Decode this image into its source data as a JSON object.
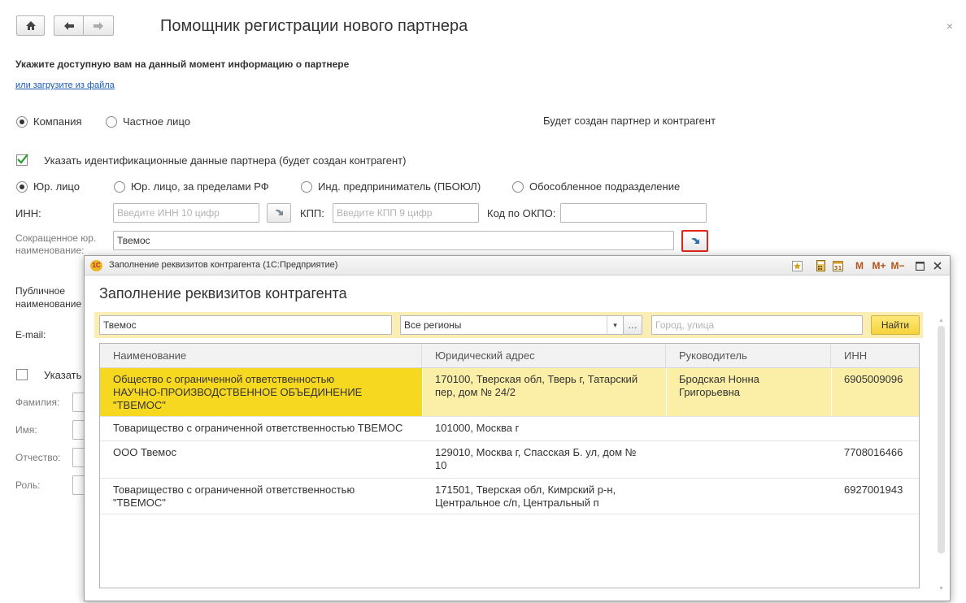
{
  "header": {
    "title": "Помощник регистрации нового партнера",
    "close_label": "×"
  },
  "intro": {
    "heading": "Укажите доступную вам на данный момент информацию о партнере",
    "load_link": "или загрузите из файла"
  },
  "partner_type": {
    "options": [
      "Компания",
      "Частное лицо"
    ],
    "selected": "Компания",
    "note": "Будет создан партнер и контрагент"
  },
  "identify": {
    "checkbox_label": "Указать идентификационные данные партнера (будет создан контрагент)",
    "checked": true
  },
  "legal_type": {
    "options": [
      "Юр. лицо",
      "Юр. лицо, за пределами РФ",
      "Инд. предприниматель (ПБОЮЛ)",
      "Обособленное подразделение"
    ],
    "selected": "Юр. лицо"
  },
  "form": {
    "inn_label": "ИНН:",
    "inn_placeholder": "Введите ИНН 10 цифр",
    "kpp_label": "КПП:",
    "kpp_placeholder": "Введите КПП 9 цифр",
    "okpo_label": "Код по ОКПО:",
    "short_name_label_1": "Сокращенное юр.",
    "short_name_label_2": "наименование:",
    "short_name_value": "Твемос",
    "public_label_1": "Публичное",
    "public_label_2": "наименование",
    "email_label": "E-mail:",
    "contact_checkbox_label": "Указать",
    "lastname_label": "Фамилия:",
    "firstname_label": "Имя:",
    "patronymic_label": "Отчество:",
    "role_label": "Роль:"
  },
  "dialog": {
    "window_title": "Заполнение реквизитов контрагента  (1С:Предприятие)",
    "logo_text": "1С",
    "toolbar": [
      "M",
      "M+",
      "M−"
    ],
    "heading": "Заполнение реквизитов контрагента",
    "search_value": "Твемос",
    "region_value": "Все регионы",
    "city_placeholder": "Город, улица",
    "find_button": "Найти",
    "columns": [
      "Наименование",
      "Юридический адрес",
      "Руководитель",
      "ИНН"
    ],
    "rows": [
      {
        "name": [
          "Общество с ограниченной ответственностью",
          "НАУЧНО-ПРОИЗВОДСТВЕННОЕ ОБЪЕДИНЕНИЕ",
          "\"ТВЕМОС\""
        ],
        "address": [
          "170100, Тверская обл, Тверь г, Татарский",
          "пер, дом № 24/2"
        ],
        "director": [
          "Бродская Нонна",
          "Григорьевна"
        ],
        "inn": "6905009096"
      },
      {
        "name": [
          "Товарищество с ограниченной ответственностью ТВЕМОС"
        ],
        "address": [
          "101000, Москва г"
        ],
        "director": [],
        "inn": ""
      },
      {
        "name": [
          "ООО Твемос"
        ],
        "address": [
          "129010, Москва г, Спасская Б. ул, дом №",
          "10"
        ],
        "director": [],
        "inn": "7708016466"
      },
      {
        "name": [
          "Товарищество с ограниченной ответственностью",
          "\"ТВЕМОС\""
        ],
        "address": [
          "171501, Тверская обл, Кимрский р-н,",
          "Центральное с/п, Центральный п"
        ],
        "director": [],
        "inn": "6927001943"
      }
    ],
    "selected_row": 0
  },
  "colors": {
    "accent_yellow": "#f7d820",
    "selection_row": "#fbeea7",
    "search_bar": "#fbeeb5",
    "highlight_border": "#e0251b"
  }
}
